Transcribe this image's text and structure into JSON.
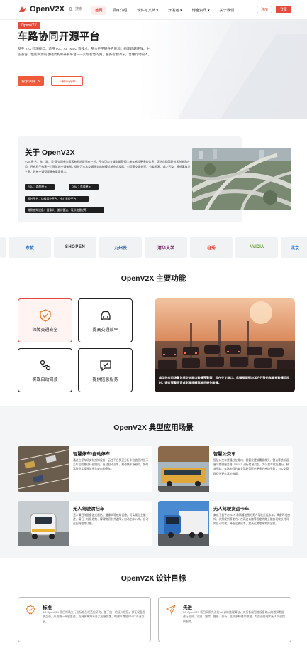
{
  "nav": {
    "logo_text": "OpenV2X",
    "search_label": "搜索",
    "links": [
      "首页",
      "项目介绍",
      "软件与文档 ▾",
      "开发者 ▾",
      "博客资讯 ▾",
      "关于我们"
    ],
    "login": "注册",
    "register": "登录"
  },
  "hero": {
    "tag": "OpenV2X",
    "title": "车路协同开源平台",
    "desc": "基于 V2X 检测接口，适用 5G、AI、MEC 等技术，整合产学研各方资源，构建跨越开放、生态兼容、性能资源的基础架构和开发平台——实现智慧的路，服务智能的车，普惠行动的人。",
    "btn_primary": "探索项目",
    "btn_secondary": "下载白皮书"
  },
  "about": {
    "title": "关于 OpenV2X",
    "text": "V2X 将“人、车、路、云”等交通参与要素有机地联系在一起，不仅可以支撑车辆获得比单车感知更多的信息，促进自动驾驶技术创新和应用；还有利于构建一个智慧的交通体系，促进汽车和交通服务的新模式新业态发展，对提高交通效率、节省资源、减少污染、降低事故发生率、改善交通管理具有重要意义。",
    "tags": [
      "RSU：路侧单元",
      "OBU：车载单元",
      "云控平台：边缘云控平台、中心云控平台",
      "路侧感知设备：摄像头、激光雷达、毫米波雷达等"
    ]
  },
  "partners": [
    "东软",
    "SHOPEN",
    "九州云",
    "清华大学",
    "谷秀",
    "NVIDIA",
    "北京"
  ],
  "features": {
    "title": "OpenV2X 主要功能",
    "items": [
      {
        "label": "保障交通安全",
        "icon": "shield-check-icon"
      },
      {
        "label": "提高交通效率",
        "icon": "car-icon"
      },
      {
        "label": "实现自动驾驶",
        "icon": "route-icon"
      },
      {
        "label": "提供信息服务",
        "icon": "message-icon"
      }
    ],
    "caption": "典型的应用场景包括交叉路口碰撞预警等，即在交叉路口，车辆探测到与其它行驶的车辆有碰撞风险时，通过预警声音或影像提醒驾驶员避免碰撞。"
  },
  "scenarios": {
    "title": "OpenV2X 典型应用场景",
    "items": [
      {
        "title": "智慧停车/自动停车",
        "text": "通过在停车场安装感知设备，云控平台负责分析车位信息并显示至车位的最佳行驶路线，驱动自动泊车，推动快车场预约，协助驾驶员实现智慧停车或自动停车。"
      },
      {
        "title": "智慧公交车",
        "text": "智慧公交车是通过在路口、重要位置部署摄像头、雷达等感知设备与路侧服务器（RSU）进行信息交互，为公交车优先通行、精准到站、车路协同的安全驾驶等提供更多的感知手段，为公交管理提供更丰富的数据。"
      },
      {
        "title": "无人驾驶清扫车",
        "text": "无人清扫车配备激光雷达、摄像头等感知设备，可实现自主循迹、清扫、垃圾收集、障碍物识别并避障，自动泊车入库，自动返回充电等功能。"
      },
      {
        "title": "无人驾驶货运卡车",
        "text": "集成了云平台 V2X 和高精地图的无人驾驶货运卡车，具备环境感知、决策规划等能力，在高速公路等固定线路上能实现较长时间的自动驾驶，降低运输成本，提高运输效率和安全性。"
      }
    ]
  },
  "goals": {
    "title": "OpenV2X 设计目标",
    "items": [
      {
        "title": "标准",
        "icon": "badge-icon",
        "text": "5G OpenV2X 项目将确立行业标准及规范化研究，基于统一的接口规范，保证设备互联互通，形成统一开放生态，支持多种跨平台大规模部署，构建车路协同V2X产业发展。"
      },
      {
        "title": "先进",
        "icon": "send-icon",
        "text": "5G OpenV2X 项目采用先进的 AI 训练推理算法，对接各级智能设备输入的感知数据进行检测、识别、跟踪、融合、分析，生成多种路口数据，为交通管理和无人驾驶提供服务。"
      }
    ]
  },
  "colors": {
    "accent": "#e64a3b",
    "hero_button": "#ef5a3a",
    "dark_tag": "#1f1f1f",
    "section_bg": "#f4f5f7"
  }
}
